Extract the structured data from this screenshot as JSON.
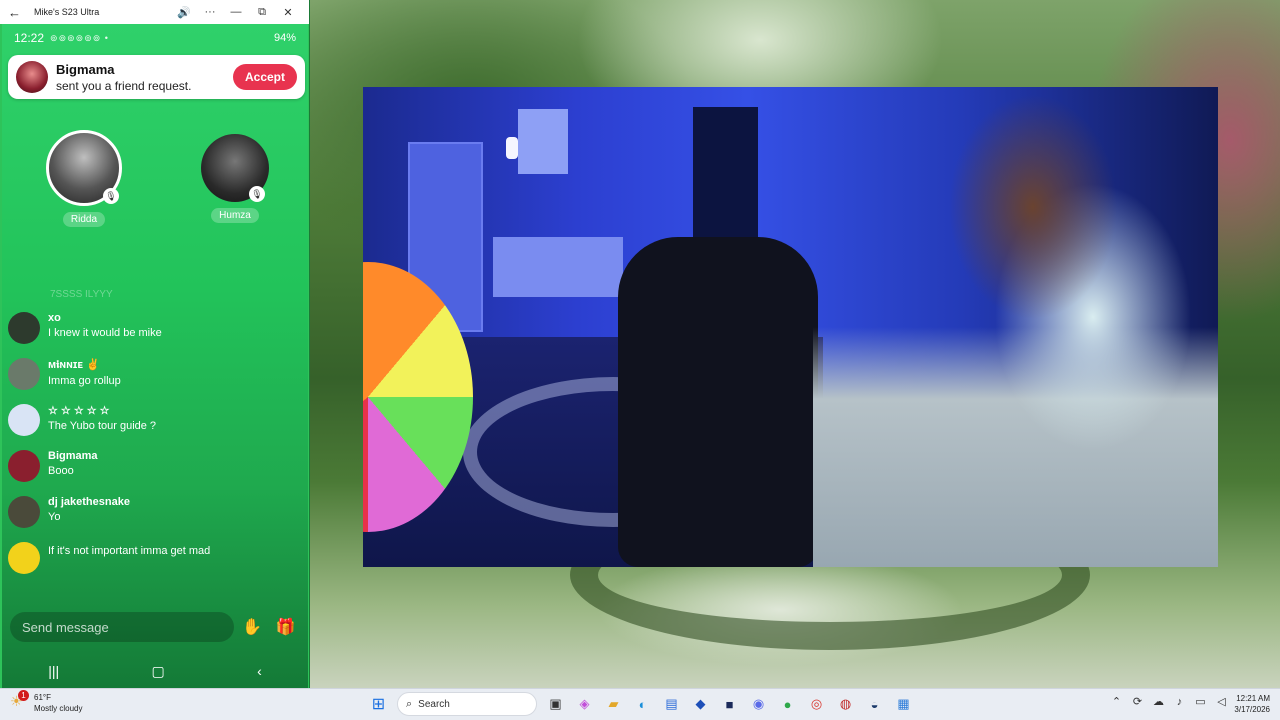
{
  "window": {
    "title": "Mike's S23 Ultra",
    "back_icon": "←",
    "audio_icon": "🔊",
    "more_icon": "···",
    "minimize_icon": "—",
    "restore_icon": "⧉",
    "close_icon": "✕"
  },
  "statusbar": {
    "time": "12:22",
    "icons": "⊚⊚⊚⊚⊚⊚ •",
    "battery": "94%"
  },
  "notification": {
    "name": "Bigmama",
    "message": "sent you a friend request.",
    "accept_label": "Accept"
  },
  "speakers": [
    {
      "name": "Ridda",
      "mic_icon": "🎙"
    },
    {
      "name": "Humza",
      "mic_icon": "🎙"
    }
  ],
  "chat": {
    "faded_line": "7SSSS ILYYY",
    "messages": [
      {
        "user": "xo",
        "text": "I knew it would be mike",
        "avatar_color": "#2d3a2d"
      },
      {
        "user": "ᴍ𝖎ɴɴɪᴇ ✌",
        "text": "Imma go rollup",
        "avatar_color": "#6a7a6a"
      },
      {
        "user": "☆ ☆ ☆ ☆ ☆",
        "text": "The Yubo tour guide ?",
        "avatar_color": "#d9e4f5"
      },
      {
        "user": "Bigmama",
        "text": "Booo",
        "avatar_color": "#8a1f2e"
      },
      {
        "user": "dj jakethesnake",
        "text": "Yo",
        "avatar_color": "#4a4a3a"
      },
      {
        "user": "",
        "text": "If it's not important imma get mad",
        "avatar_color": "#f2d21b"
      }
    ]
  },
  "composer": {
    "placeholder": "Send message",
    "wave_icon": "✋",
    "gift_icon": "🎁"
  },
  "navbar": {
    "recents": "|||",
    "home": "▢",
    "back": "‹"
  },
  "taskbar": {
    "weather_badge": "1",
    "temperature": "61°F",
    "condition": "Mostly cloudy",
    "search_label": "Search",
    "time": "12:21 AM",
    "date": "3/17/2026"
  }
}
